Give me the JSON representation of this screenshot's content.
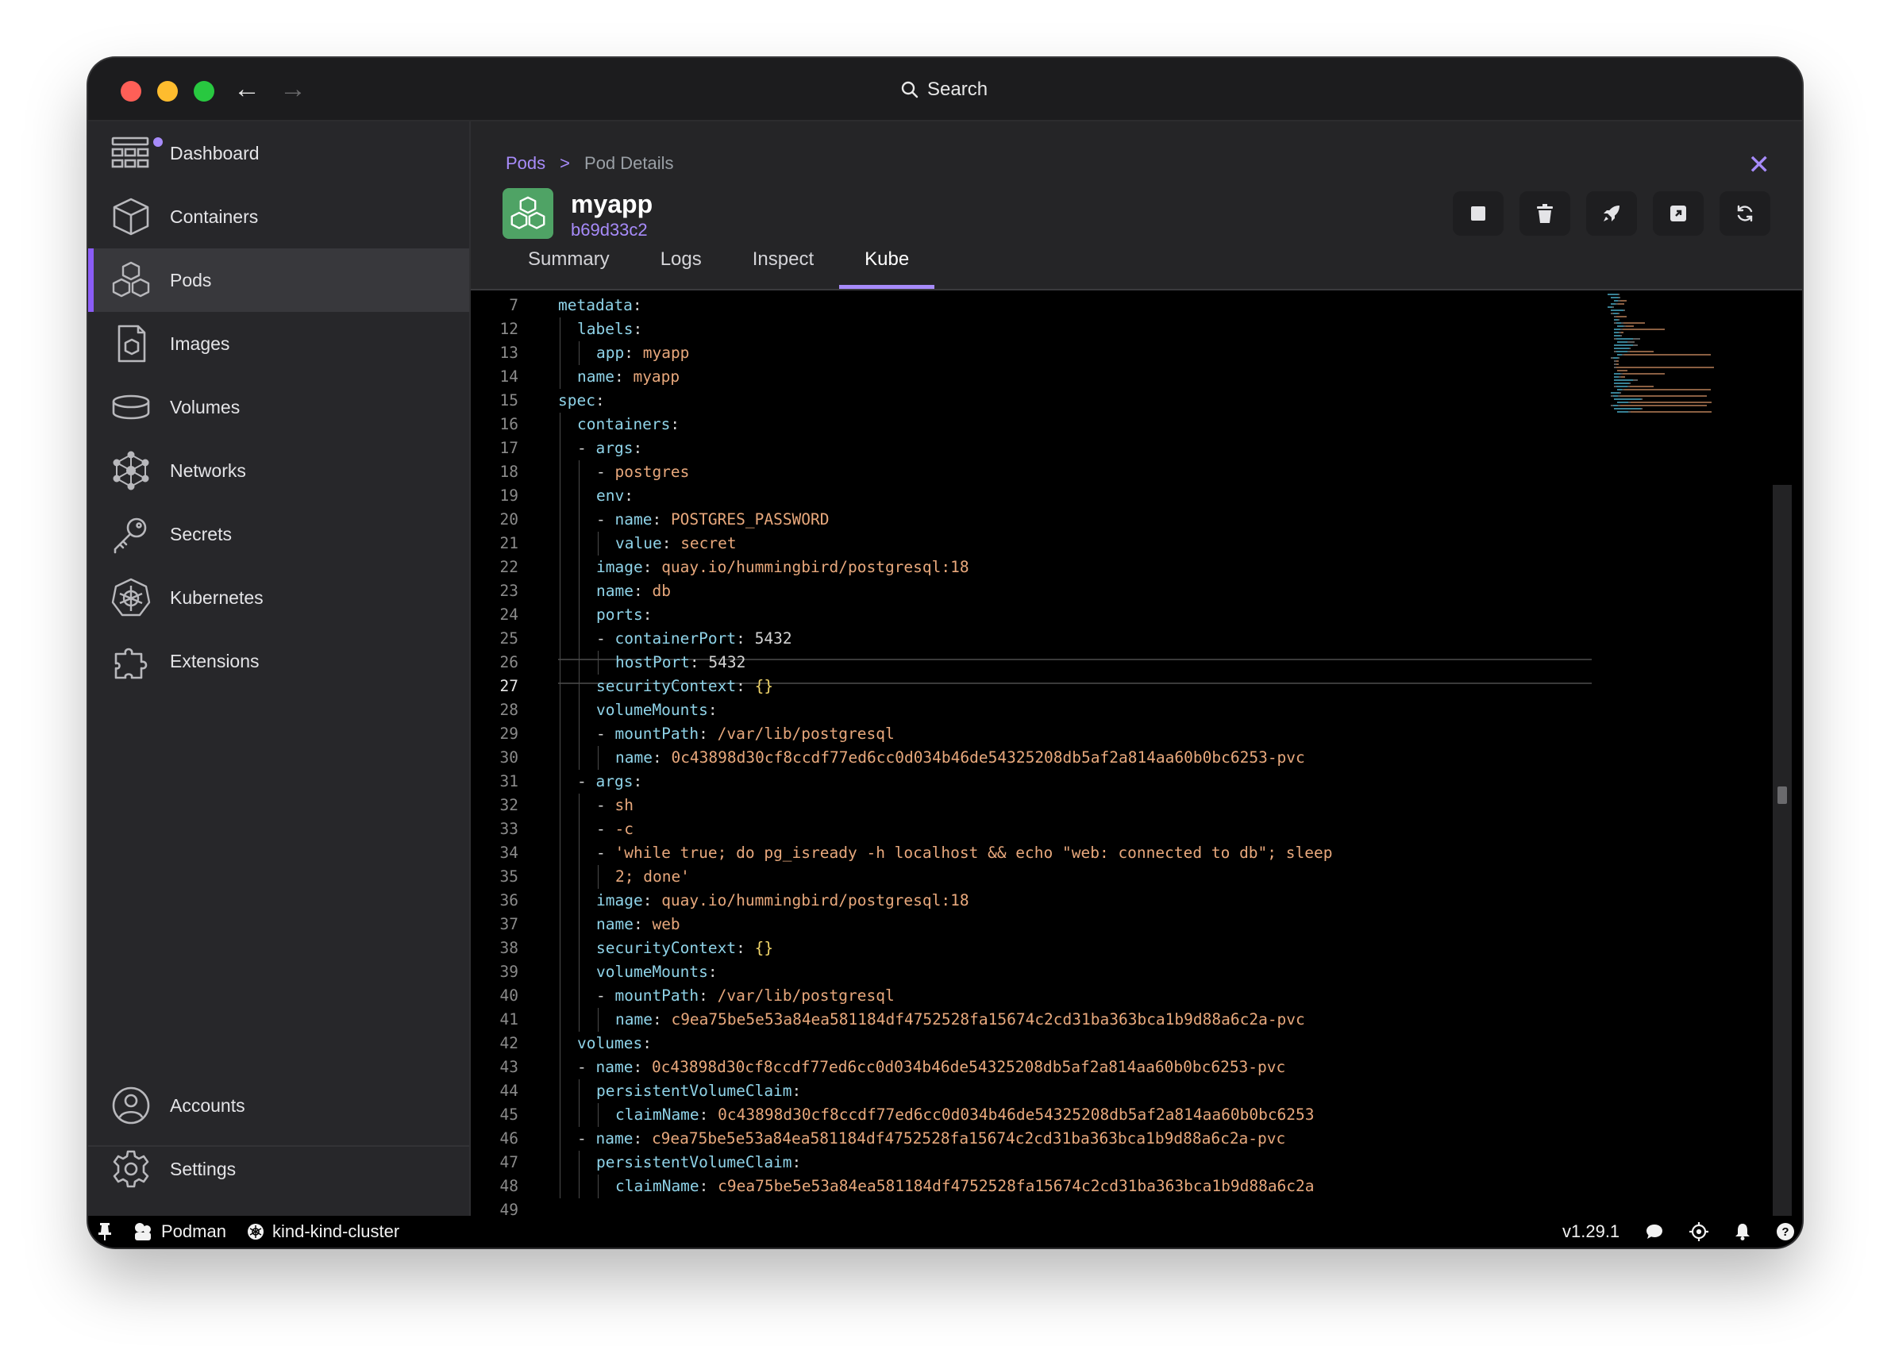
{
  "titlebar": {
    "search_label": "Search"
  },
  "sidebar": {
    "items": [
      {
        "label": "Dashboard",
        "icon": "dashboard-icon"
      },
      {
        "label": "Containers",
        "icon": "container-icon"
      },
      {
        "label": "Pods",
        "icon": "pod-icon",
        "active": true
      },
      {
        "label": "Images",
        "icon": "image-icon"
      },
      {
        "label": "Volumes",
        "icon": "volume-icon"
      },
      {
        "label": "Networks",
        "icon": "network-icon"
      },
      {
        "label": "Secrets",
        "icon": "key-icon"
      },
      {
        "label": "Kubernetes",
        "icon": "kubernetes-icon"
      },
      {
        "label": "Extensions",
        "icon": "puzzle-icon"
      }
    ],
    "bottom": [
      {
        "label": "Accounts",
        "icon": "account-icon"
      },
      {
        "label": "Settings",
        "icon": "gear-icon"
      }
    ]
  },
  "breadcrumb": {
    "parent": "Pods",
    "separator": ">",
    "current": "Pod Details"
  },
  "pod": {
    "name": "myapp",
    "id": "b69d33c2"
  },
  "tabs": [
    "Summary",
    "Logs",
    "Inspect",
    "Kube"
  ],
  "active_tab": "Kube",
  "editor": {
    "current_line": 27,
    "lines": [
      {
        "n": "7",
        "indent": 0,
        "tokens": [
          [
            "k",
            "metadata"
          ],
          [
            "p",
            ":"
          ]
        ]
      },
      {
        "n": "12",
        "indent": 1,
        "tokens": [
          [
            "k",
            "labels"
          ],
          [
            "p",
            ":"
          ]
        ]
      },
      {
        "n": "13",
        "indent": 2,
        "tokens": [
          [
            "k",
            "app"
          ],
          [
            "p",
            ": "
          ],
          [
            "v",
            "myapp"
          ]
        ]
      },
      {
        "n": "14",
        "indent": 1,
        "tokens": [
          [
            "k",
            "name"
          ],
          [
            "p",
            ": "
          ],
          [
            "v",
            "myapp"
          ]
        ]
      },
      {
        "n": "15",
        "indent": 0,
        "tokens": [
          [
            "k",
            "spec"
          ],
          [
            "p",
            ":"
          ]
        ]
      },
      {
        "n": "16",
        "indent": 1,
        "tokens": [
          [
            "k",
            "containers"
          ],
          [
            "p",
            ":"
          ]
        ]
      },
      {
        "n": "17",
        "indent": 1,
        "tokens": [
          [
            "p",
            "- "
          ],
          [
            "k",
            "args"
          ],
          [
            "p",
            ":"
          ]
        ]
      },
      {
        "n": "18",
        "indent": 2,
        "tokens": [
          [
            "p",
            "- "
          ],
          [
            "v",
            "postgres"
          ]
        ]
      },
      {
        "n": "19",
        "indent": 2,
        "tokens": [
          [
            "k",
            "env"
          ],
          [
            "p",
            ":"
          ]
        ]
      },
      {
        "n": "20",
        "indent": 2,
        "tokens": [
          [
            "p",
            "- "
          ],
          [
            "k",
            "name"
          ],
          [
            "p",
            ": "
          ],
          [
            "v",
            "POSTGRES_PASSWORD"
          ]
        ]
      },
      {
        "n": "21",
        "indent": 3,
        "tokens": [
          [
            "k",
            "value"
          ],
          [
            "p",
            ": "
          ],
          [
            "v",
            "secret"
          ]
        ]
      },
      {
        "n": "22",
        "indent": 2,
        "tokens": [
          [
            "k",
            "image"
          ],
          [
            "p",
            ": "
          ],
          [
            "v",
            "quay.io/hummingbird/postgresql:18"
          ]
        ]
      },
      {
        "n": "23",
        "indent": 2,
        "tokens": [
          [
            "k",
            "name"
          ],
          [
            "p",
            ": "
          ],
          [
            "v",
            "db"
          ]
        ]
      },
      {
        "n": "24",
        "indent": 2,
        "tokens": [
          [
            "k",
            "ports"
          ],
          [
            "p",
            ":"
          ]
        ]
      },
      {
        "n": "25",
        "indent": 2,
        "tokens": [
          [
            "p",
            "- "
          ],
          [
            "k",
            "containerPort"
          ],
          [
            "p",
            ": "
          ],
          [
            "n",
            "5432"
          ]
        ]
      },
      {
        "n": "26",
        "indent": 3,
        "tokens": [
          [
            "k",
            "hostPort"
          ],
          [
            "p",
            ": "
          ],
          [
            "n",
            "5432"
          ]
        ]
      },
      {
        "n": "27",
        "indent": 2,
        "tokens": [
          [
            "k",
            "securityContext"
          ],
          [
            "p",
            ": "
          ],
          [
            "b",
            "{}"
          ]
        ]
      },
      {
        "n": "28",
        "indent": 2,
        "tokens": [
          [
            "k",
            "volumeMounts"
          ],
          [
            "p",
            ":"
          ]
        ]
      },
      {
        "n": "29",
        "indent": 2,
        "tokens": [
          [
            "p",
            "- "
          ],
          [
            "k",
            "mountPath"
          ],
          [
            "p",
            ": "
          ],
          [
            "v",
            "/var/lib/postgresql"
          ]
        ]
      },
      {
        "n": "30",
        "indent": 3,
        "tokens": [
          [
            "k",
            "name"
          ],
          [
            "p",
            ": "
          ],
          [
            "v",
            "0c43898d30cf8ccdf77ed6cc0d034b46de54325208db5af2a814aa60b0bc6253-pvc"
          ]
        ]
      },
      {
        "n": "31",
        "indent": 1,
        "tokens": [
          [
            "p",
            "- "
          ],
          [
            "k",
            "args"
          ],
          [
            "p",
            ":"
          ]
        ]
      },
      {
        "n": "32",
        "indent": 2,
        "tokens": [
          [
            "p",
            "- "
          ],
          [
            "v",
            "sh"
          ]
        ]
      },
      {
        "n": "33",
        "indent": 2,
        "tokens": [
          [
            "p",
            "- "
          ],
          [
            "v",
            "-c"
          ]
        ]
      },
      {
        "n": "34",
        "indent": 2,
        "tokens": [
          [
            "p",
            "- "
          ],
          [
            "v",
            "'while true; do pg_isready -h localhost && echo \"web: connected to db\"; sleep"
          ]
        ]
      },
      {
        "n": "35",
        "indent": 3,
        "tokens": [
          [
            "v",
            "2; done'"
          ]
        ]
      },
      {
        "n": "36",
        "indent": 2,
        "tokens": [
          [
            "k",
            "image"
          ],
          [
            "p",
            ": "
          ],
          [
            "v",
            "quay.io/hummingbird/postgresql:18"
          ]
        ]
      },
      {
        "n": "37",
        "indent": 2,
        "tokens": [
          [
            "k",
            "name"
          ],
          [
            "p",
            ": "
          ],
          [
            "v",
            "web"
          ]
        ]
      },
      {
        "n": "38",
        "indent": 2,
        "tokens": [
          [
            "k",
            "securityContext"
          ],
          [
            "p",
            ": "
          ],
          [
            "b",
            "{}"
          ]
        ]
      },
      {
        "n": "39",
        "indent": 2,
        "tokens": [
          [
            "k",
            "volumeMounts"
          ],
          [
            "p",
            ":"
          ]
        ]
      },
      {
        "n": "40",
        "indent": 2,
        "tokens": [
          [
            "p",
            "- "
          ],
          [
            "k",
            "mountPath"
          ],
          [
            "p",
            ": "
          ],
          [
            "v",
            "/var/lib/postgresql"
          ]
        ]
      },
      {
        "n": "41",
        "indent": 3,
        "tokens": [
          [
            "k",
            "name"
          ],
          [
            "p",
            ": "
          ],
          [
            "v",
            "c9ea75be5e53a84ea581184df4752528fa15674c2cd31ba363bca1b9d88a6c2a-pvc"
          ]
        ]
      },
      {
        "n": "42",
        "indent": 1,
        "tokens": [
          [
            "k",
            "volumes"
          ],
          [
            "p",
            ":"
          ]
        ]
      },
      {
        "n": "43",
        "indent": 1,
        "tokens": [
          [
            "p",
            "- "
          ],
          [
            "k",
            "name"
          ],
          [
            "p",
            ": "
          ],
          [
            "v",
            "0c43898d30cf8ccdf77ed6cc0d034b46de54325208db5af2a814aa60b0bc6253-pvc"
          ]
        ]
      },
      {
        "n": "44",
        "indent": 2,
        "tokens": [
          [
            "k",
            "persistentVolumeClaim"
          ],
          [
            "p",
            ":"
          ]
        ]
      },
      {
        "n": "45",
        "indent": 3,
        "tokens": [
          [
            "k",
            "claimName"
          ],
          [
            "p",
            ": "
          ],
          [
            "v",
            "0c43898d30cf8ccdf77ed6cc0d034b46de54325208db5af2a814aa60b0bc6253"
          ]
        ]
      },
      {
        "n": "46",
        "indent": 1,
        "tokens": [
          [
            "p",
            "- "
          ],
          [
            "k",
            "name"
          ],
          [
            "p",
            ": "
          ],
          [
            "v",
            "c9ea75be5e53a84ea581184df4752528fa15674c2cd31ba363bca1b9d88a6c2a-pvc"
          ]
        ]
      },
      {
        "n": "47",
        "indent": 2,
        "tokens": [
          [
            "k",
            "persistentVolumeClaim"
          ],
          [
            "p",
            ":"
          ]
        ]
      },
      {
        "n": "48",
        "indent": 3,
        "tokens": [
          [
            "k",
            "claimName"
          ],
          [
            "p",
            ": "
          ],
          [
            "v",
            "c9ea75be5e53a84ea581184df4752528fa15674c2cd31ba363bca1b9d88a6c2a"
          ]
        ]
      },
      {
        "n": "49",
        "indent": 0,
        "tokens": []
      }
    ]
  },
  "statusbar": {
    "engine": "Podman",
    "cluster": "kind-kind-cluster",
    "version": "v1.29.1"
  },
  "colors": {
    "accent": "#a78bfa",
    "pod_icon_bg": "#4fa365",
    "yaml_key": "#8fd3e8",
    "yaml_value": "#e8a87c"
  }
}
